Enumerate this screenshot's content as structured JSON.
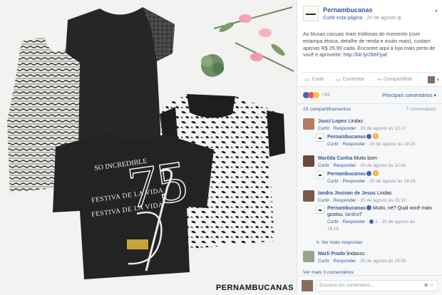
{
  "photo": {
    "brand": "PERNAMBUCANAS",
    "shirt_text": {
      "line1": "SO INCREDIBLE",
      "line2": "FESTIVA DE LA VIDA",
      "line3": "FESTIVA DE LA VIDA",
      "big_number": "75"
    }
  },
  "post": {
    "page_name": "Pernambucanas",
    "follow_label": "Curtir esta página",
    "date": "20 de agosto",
    "text": "As blusas casuais mais estilosas do momento (com estampa étnica, detalhe de renda e muito mais), custam apenas R$ 29,99 cada. Encontre aqui a loja mais perto de você e aproveite:",
    "link": "http://bit.ly/2b6Fpaf",
    "actions": {
      "like": "Curtir",
      "comment": "Comentar",
      "share": "Compartilhar"
    },
    "reaction_count": "749",
    "sort_label": "Principais comentários",
    "shares": "23 compartilhamentos",
    "comments_count": "7 comentários"
  },
  "comments": [
    {
      "name": "Jusci Lopes",
      "text": "Lindas",
      "meta": "20 de agosto às 13:17"
    },
    {
      "name": "Pernambucanas",
      "text": "",
      "meta": "20 de agosto às 18:16",
      "reply": true
    },
    {
      "name": "Marilda Cunha",
      "text": "Muito bom",
      "meta": "20 de agosto às 10:42"
    },
    {
      "name": "Pernambucanas",
      "text": "",
      "meta": "20 de agosto às 18:16",
      "reply": true
    },
    {
      "name": "Iandra Josivan de Jesus",
      "text": "Lindas",
      "meta": "20 de agosto às 15:10"
    },
    {
      "name": "Pernambucanas",
      "text": "Muito, né? Qual você mais gostou,",
      "mention": "Iandra",
      "meta": "20 de agosto às",
      "meta2": "18:16",
      "likes": "1",
      "reply": true
    },
    {
      "name": "Marli Prado",
      "text": "lindasss",
      "meta": "20 de agosto às 19:00"
    }
  ],
  "meta_labels": {
    "like": "Curtir",
    "reply": "Responder"
  },
  "more_replies": "Ver mais respostas",
  "more_comments": "Ver mais 3 comentários",
  "write_placeholder": "Escreva um comentário..."
}
